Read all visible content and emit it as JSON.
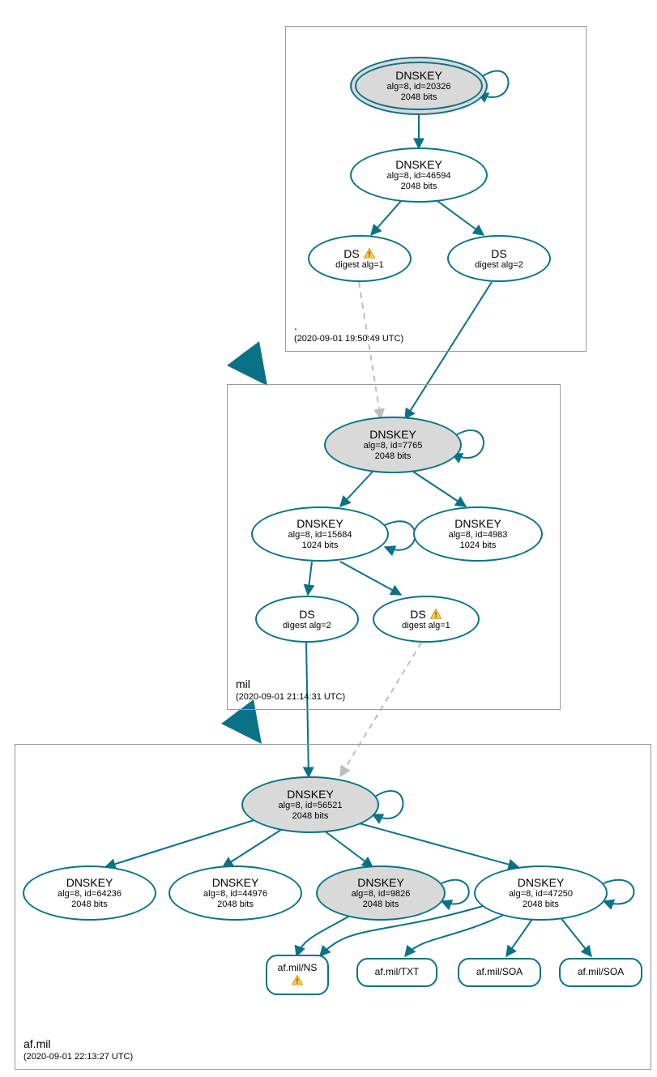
{
  "colors": {
    "teal": "#0b7285",
    "gray_fill": "#d9d9d9",
    "dashed": "#bdbdbd"
  },
  "zones": {
    "root": {
      "name": ".",
      "timestamp": "(2020-09-01 19:50:49 UTC)"
    },
    "mil": {
      "name": "mil",
      "timestamp": "(2020-09-01 21:14:31 UTC)"
    },
    "afmil": {
      "name": "af.mil",
      "timestamp": "(2020-09-01 22:13:27 UTC)"
    }
  },
  "nodes": {
    "root_ksk": {
      "title": "DNSKEY",
      "line2": "alg=8, id=20326",
      "line3": "2048 bits"
    },
    "root_zsk": {
      "title": "DNSKEY",
      "line2": "alg=8, id=46594",
      "line3": "2048 bits"
    },
    "root_ds1": {
      "title": "DS",
      "line2": "digest alg=1",
      "warn": true
    },
    "root_ds2": {
      "title": "DS",
      "line2": "digest alg=2"
    },
    "mil_ksk": {
      "title": "DNSKEY",
      "line2": "alg=8, id=7765",
      "line3": "2048 bits"
    },
    "mil_zsk1": {
      "title": "DNSKEY",
      "line2": "alg=8, id=15684",
      "line3": "1024 bits"
    },
    "mil_zsk2": {
      "title": "DNSKEY",
      "line2": "alg=8, id=4983",
      "line3": "1024 bits"
    },
    "mil_ds2": {
      "title": "DS",
      "line2": "digest alg=2"
    },
    "mil_ds1": {
      "title": "DS",
      "line2": "digest alg=1",
      "warn": true
    },
    "af_ksk": {
      "title": "DNSKEY",
      "line2": "alg=8, id=56521",
      "line3": "2048 bits"
    },
    "af_k1": {
      "title": "DNSKEY",
      "line2": "alg=8, id=64236",
      "line3": "2048 bits"
    },
    "af_k2": {
      "title": "DNSKEY",
      "line2": "alg=8, id=44976",
      "line3": "2048 bits"
    },
    "af_k3": {
      "title": "DNSKEY",
      "line2": "alg=8, id=9826",
      "line3": "2048 bits"
    },
    "af_k4": {
      "title": "DNSKEY",
      "line2": "alg=8, id=47250",
      "line3": "2048 bits"
    },
    "rec_ns": {
      "label": "af.mil/NS",
      "warn": true
    },
    "rec_txt": {
      "label": "af.mil/TXT"
    },
    "rec_soa1": {
      "label": "af.mil/SOA"
    },
    "rec_soa2": {
      "label": "af.mil/SOA"
    }
  }
}
